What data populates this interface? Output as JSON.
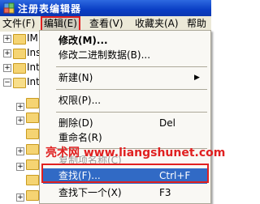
{
  "window": {
    "title": "注册表编辑器",
    "app_icon": "regedit-icon"
  },
  "menubar": {
    "items": [
      {
        "label": "文件(F)"
      },
      {
        "label": "编辑(E)"
      },
      {
        "label": "查看(V)"
      },
      {
        "label": "收藏夹(A)"
      },
      {
        "label": "帮助"
      }
    ]
  },
  "tree": {
    "rows": [
      {
        "label": "IME"
      },
      {
        "label": "Ins"
      },
      {
        "label": "Int"
      },
      {
        "label": "Int"
      }
    ]
  },
  "edit_menu": {
    "items": [
      {
        "label": "修改(M)...",
        "shortcut": ""
      },
      {
        "label": "修改二进制数据(B)...",
        "shortcut": ""
      },
      {
        "label": "新建(N)",
        "shortcut": ""
      },
      {
        "label": "权限(P)...",
        "shortcut": ""
      },
      {
        "label": "删除(D)",
        "shortcut": "Del"
      },
      {
        "label": "重命名(R)",
        "shortcut": ""
      },
      {
        "label": "复制项名称(C)",
        "shortcut": ""
      },
      {
        "label": "查找(F)...",
        "shortcut": "Ctrl+F"
      },
      {
        "label": "查找下一个(X)",
        "shortcut": "F3"
      }
    ]
  },
  "watermark": {
    "text": "亮术网 www.liangshunet.com"
  },
  "colors": {
    "highlight": "#316ac5",
    "annotation_red": "#e02020",
    "titlebar": "#0a3ec4"
  }
}
